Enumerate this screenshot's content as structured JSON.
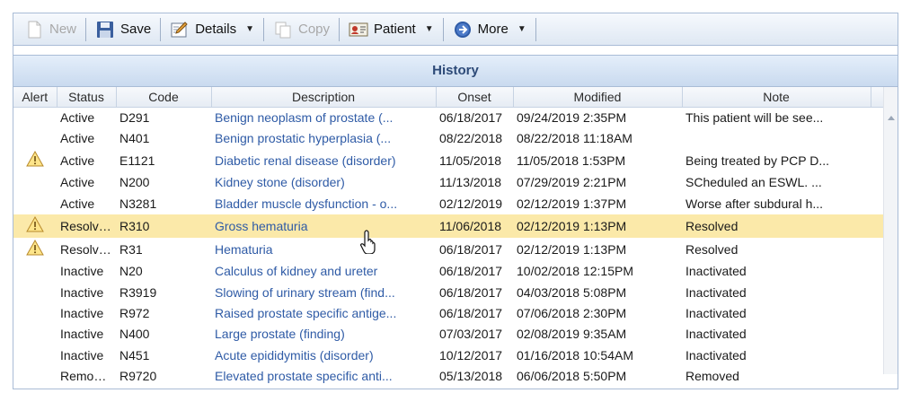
{
  "toolbar": {
    "new_label": "New",
    "save_label": "Save",
    "details_label": "Details",
    "copy_label": "Copy",
    "patient_label": "Patient",
    "more_label": "More"
  },
  "panel": {
    "title": "History"
  },
  "columns": [
    "Alert",
    "Status",
    "Code",
    "Description",
    "Onset",
    "Modified",
    "Note"
  ],
  "rows": [
    {
      "alert": false,
      "status": "Active",
      "code": "D291",
      "description": "Benign neoplasm of prostate (...",
      "onset": "06/18/2017",
      "modified": "09/24/2019 2:35PM",
      "note": "This patient will be see..."
    },
    {
      "alert": false,
      "status": "Active",
      "code": "N401",
      "description": "Benign prostatic hyperplasia (...",
      "onset": "08/22/2018",
      "modified": "08/22/2018 11:18AM",
      "note": ""
    },
    {
      "alert": true,
      "status": "Active",
      "code": "E1121",
      "description": "Diabetic renal disease (disorder)",
      "onset": "11/05/2018",
      "modified": "11/05/2018 1:53PM",
      "note": "Being treated by PCP D..."
    },
    {
      "alert": false,
      "status": "Active",
      "code": "N200",
      "description": "Kidney stone (disorder)",
      "onset": "11/13/2018",
      "modified": "07/29/2019 2:21PM",
      "note": "SCheduled an ESWL. ..."
    },
    {
      "alert": false,
      "status": "Active",
      "code": "N3281",
      "description": "Bladder muscle dysfunction - o...",
      "onset": "02/12/2019",
      "modified": "02/12/2019 1:37PM",
      "note": "Worse after subdural h..."
    },
    {
      "alert": true,
      "selected": true,
      "status": "Resolved",
      "code": "R310",
      "description": "Gross hematuria",
      "onset": "11/06/2018",
      "modified": "02/12/2019 1:13PM",
      "note": "Resolved"
    },
    {
      "alert": true,
      "status": "Resolved",
      "code": "R31",
      "description": "Hematuria",
      "onset": "06/18/2017",
      "modified": "02/12/2019 1:13PM",
      "note": "Resolved"
    },
    {
      "alert": false,
      "status": "Inactive",
      "code": "N20",
      "description": "Calculus of kidney and ureter",
      "onset": "06/18/2017",
      "modified": "10/02/2018 12:15PM",
      "note": "Inactivated"
    },
    {
      "alert": false,
      "status": "Inactive",
      "code": "R3919",
      "description": "Slowing of urinary stream (find...",
      "onset": "06/18/2017",
      "modified": "04/03/2018 5:08PM",
      "note": "Inactivated"
    },
    {
      "alert": false,
      "status": "Inactive",
      "code": "R972",
      "description": "Raised prostate specific antige...",
      "onset": "06/18/2017",
      "modified": "07/06/2018 2:30PM",
      "note": "Inactivated"
    },
    {
      "alert": false,
      "status": "Inactive",
      "code": "N400",
      "description": "Large prostate (finding)",
      "onset": "07/03/2017",
      "modified": "02/08/2019 9:35AM",
      "note": "Inactivated"
    },
    {
      "alert": false,
      "status": "Inactive",
      "code": "N451",
      "description": "Acute epididymitis (disorder)",
      "onset": "10/12/2017",
      "modified": "01/16/2018 10:54AM",
      "note": "Inactivated"
    },
    {
      "alert": false,
      "status": "Removed",
      "code": "R9720",
      "description": "Elevated prostate specific anti...",
      "onset": "05/13/2018",
      "modified": "06/06/2018 5:50PM",
      "note": "Removed"
    }
  ]
}
